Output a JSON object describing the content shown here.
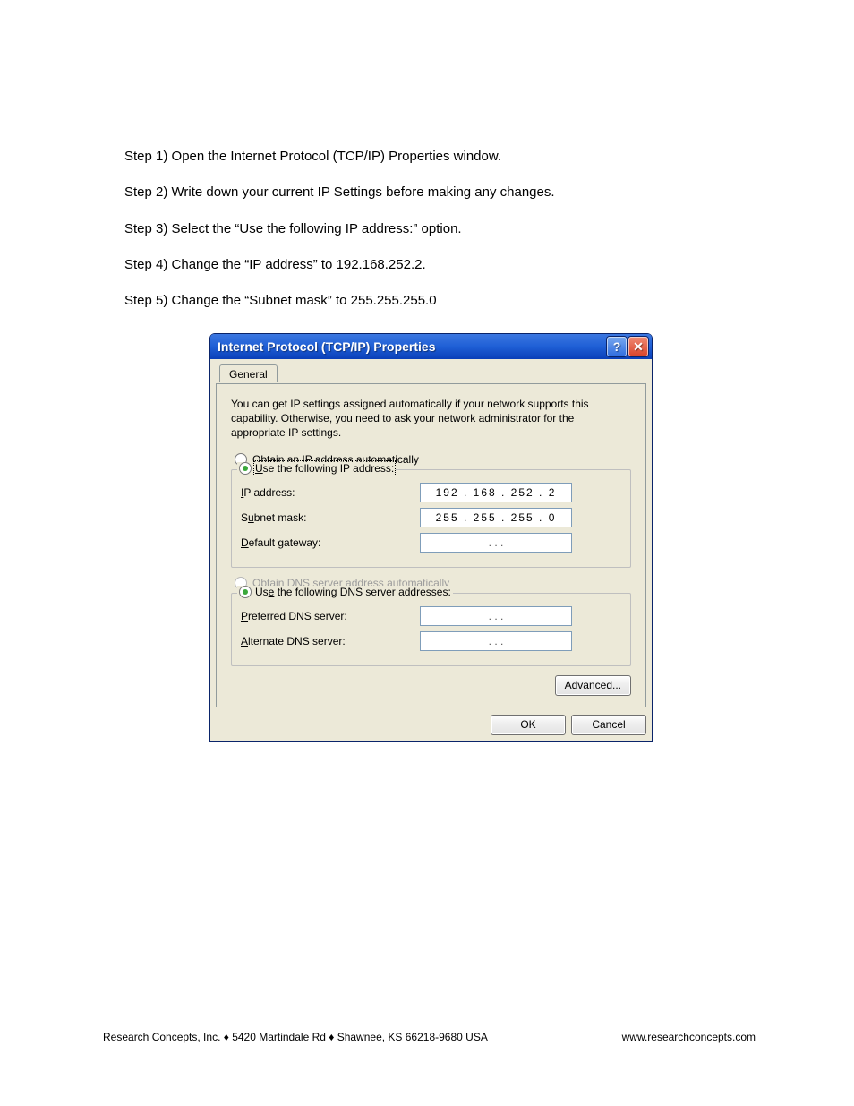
{
  "steps": [
    "Step 1) Open the Internet Protocol (TCP/IP) Properties window.",
    "Step 2) Write down your current IP Settings before making any changes.",
    "Step 3) Select the “Use the following IP address:” option.",
    "Step 4) Change the “IP address” to 192.168.252.2.",
    "Step 5) Change the “Subnet mask” to 255.255.255.0"
  ],
  "window": {
    "title": "Internet Protocol (TCP/IP) Properties",
    "help_symbol": "?",
    "close_symbol": "✕",
    "tab": "General",
    "description": "You can get IP settings assigned automatically if your network supports this capability. Otherwise, you need to ask your network administrator for the appropriate IP settings.",
    "ip_group": {
      "auto_label_pre": "O",
      "auto_label_post": "btain an IP address automatically",
      "manual_label_pre": "U",
      "manual_label_post": "se the following IP address:",
      "rows": {
        "ip_label_pre": "I",
        "ip_label_post": "P address:",
        "ip_value": "192 . 168 . 252 .   2",
        "subnet_label_pre": "S",
        "subnet_label_mid": "u",
        "subnet_label_post": "bnet mask:",
        "subnet_value": "255 . 255 . 255 .   0",
        "gateway_label_pre": "D",
        "gateway_label_post": "efault gateway:",
        "gateway_value": ".          .          ."
      }
    },
    "dns_group": {
      "auto_label_pre": "O",
      "auto_label_mid": "b",
      "auto_label_post": "tain DNS server address automatically",
      "manual_label_pre": "Us",
      "manual_label_mid": "e",
      "manual_label_post": " the following DNS server addresses:",
      "rows": {
        "pref_label_pre": "P",
        "pref_label_post": "referred DNS server:",
        "pref_value": ".          .          .",
        "alt_label_pre": "A",
        "alt_label_post": "lternate DNS server:",
        "alt_value": ".          .          ."
      }
    },
    "advanced_label_pre": "Ad",
    "advanced_label_mid": "v",
    "advanced_label_post": "anced...",
    "ok_label": "OK",
    "cancel_label": "Cancel"
  },
  "footer": {
    "left": "Research Concepts, Inc. ♦ 5420 Martindale Rd ♦ Shawnee, KS 66218-9680 USA",
    "right": "www.researchconcepts.com"
  }
}
